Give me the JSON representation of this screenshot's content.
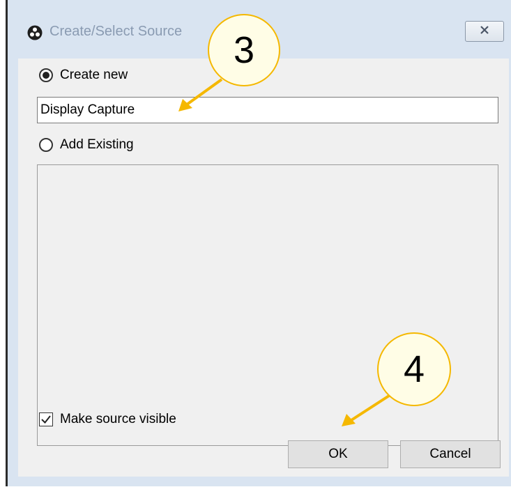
{
  "window": {
    "title": "Create/Select Source",
    "close_icon": "close-x-icon",
    "app_icon": "obs-logo-icon"
  },
  "options": {
    "create_new_label": "Create new",
    "create_new_selected": true,
    "source_name_value": "Display Capture",
    "add_existing_label": "Add Existing",
    "add_existing_selected": false,
    "existing_sources": []
  },
  "visibility": {
    "label": "Make source visible",
    "checked": true
  },
  "buttons": {
    "ok_label": "OK",
    "cancel_label": "Cancel"
  },
  "annotations": {
    "step_3": "3",
    "step_4": "4",
    "accent_color": "#f5b800"
  }
}
